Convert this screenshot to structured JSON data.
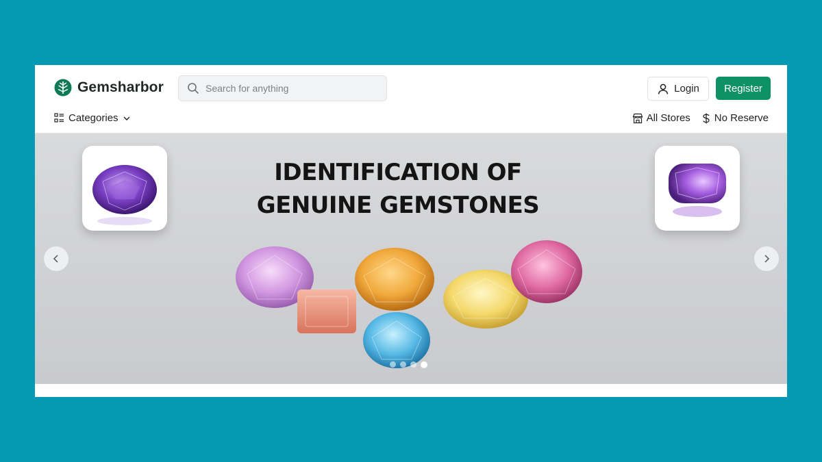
{
  "brand": {
    "name": "Gemsharbor",
    "accent": "#0e9165"
  },
  "search": {
    "placeholder": "Search for anything",
    "icon": "search-icon"
  },
  "header": {
    "login_label": "Login",
    "register_label": "Register"
  },
  "nav": {
    "categories_label": "Categories",
    "links": [
      {
        "label": "All Stores",
        "icon": "store-icon"
      },
      {
        "label": "No Reserve",
        "icon": "dollar-icon"
      }
    ]
  },
  "hero": {
    "title_line1": "IDENTIFICATION OF",
    "title_line2": "GENUINE GEMSTONES",
    "slide_count": 4,
    "active_slide": 4
  },
  "colors": {
    "background": "#0599b4",
    "hero_bg": "#d2d3d6"
  }
}
